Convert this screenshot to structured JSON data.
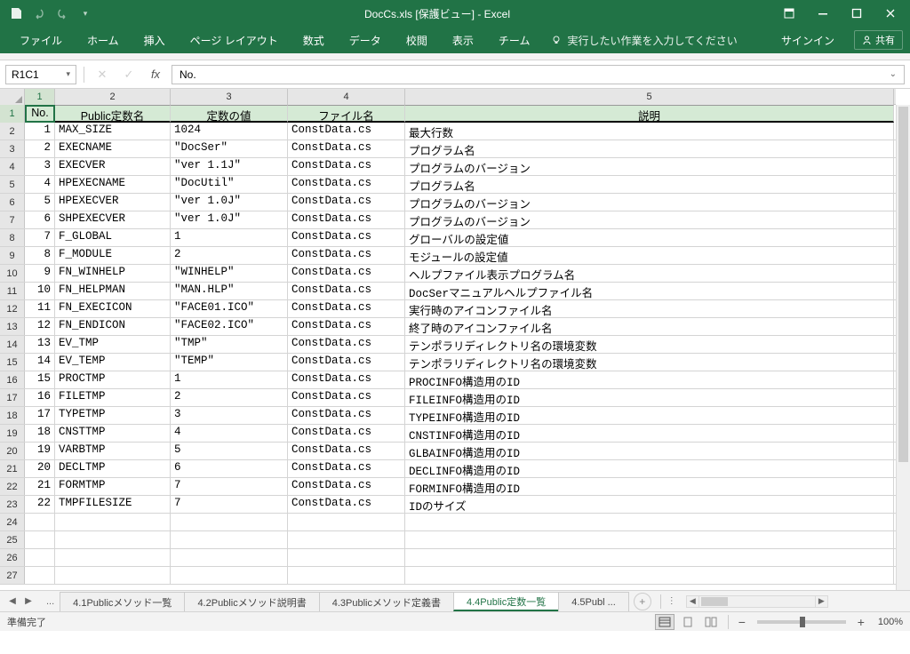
{
  "window": {
    "title": "DocCs.xls  [保護ビュー] - Excel",
    "signin": "サインイン",
    "share": "共有"
  },
  "ribbon": {
    "tabs": [
      "ファイル",
      "ホーム",
      "挿入",
      "ページ レイアウト",
      "数式",
      "データ",
      "校閲",
      "表示",
      "チーム"
    ],
    "tell_me": "実行したい作業を入力してください"
  },
  "formula_bar": {
    "name_box": "R1C1",
    "value": "No."
  },
  "columns": [
    "1",
    "2",
    "3",
    "4",
    "5"
  ],
  "headers": {
    "no": "No.",
    "name": "Public定数名",
    "val": "定数の値",
    "file": "ファイル名",
    "desc": "説明"
  },
  "rows": [
    {
      "no": "1",
      "name": "MAX_SIZE",
      "val": "1024",
      "file": "ConstData.cs",
      "desc": "最大行数"
    },
    {
      "no": "2",
      "name": "EXECNAME",
      "val": "\"DocSer\"",
      "file": "ConstData.cs",
      "desc": "プログラム名"
    },
    {
      "no": "3",
      "name": "EXECVER",
      "val": "\"ver 1.1J\"",
      "file": "ConstData.cs",
      "desc": "プログラムのバージョン"
    },
    {
      "no": "4",
      "name": "HPEXECNAME",
      "val": "\"DocUtil\"",
      "file": "ConstData.cs",
      "desc": "プログラム名"
    },
    {
      "no": "5",
      "name": "HPEXECVER",
      "val": "\"ver 1.0J\"",
      "file": "ConstData.cs",
      "desc": "プログラムのバージョン"
    },
    {
      "no": "6",
      "name": "SHPEXECVER",
      "val": "\"ver 1.0J\"",
      "file": "ConstData.cs",
      "desc": "プログラムのバージョン"
    },
    {
      "no": "7",
      "name": "F_GLOBAL",
      "val": "1",
      "file": "ConstData.cs",
      "desc": "グローバルの設定値"
    },
    {
      "no": "8",
      "name": "F_MODULE",
      "val": "2",
      "file": "ConstData.cs",
      "desc": "モジュールの設定値"
    },
    {
      "no": "9",
      "name": "FN_WINHELP",
      "val": "\"WINHELP\"",
      "file": "ConstData.cs",
      "desc": "ヘルプファイル表示プログラム名"
    },
    {
      "no": "10",
      "name": "FN_HELPMAN",
      "val": "\"MAN.HLP\"",
      "file": "ConstData.cs",
      "desc": "DocSerマニュアルヘルプファイル名"
    },
    {
      "no": "11",
      "name": "FN_EXECICON",
      "val": "\"FACE01.ICO\"",
      "file": "ConstData.cs",
      "desc": "実行時のアイコンファイル名"
    },
    {
      "no": "12",
      "name": "FN_ENDICON",
      "val": "\"FACE02.ICO\"",
      "file": "ConstData.cs",
      "desc": "終了時のアイコンファイル名"
    },
    {
      "no": "13",
      "name": "EV_TMP",
      "val": "\"TMP\"",
      "file": "ConstData.cs",
      "desc": "テンポラリディレクトリ名の環境変数"
    },
    {
      "no": "14",
      "name": "EV_TEMP",
      "val": "\"TEMP\"",
      "file": "ConstData.cs",
      "desc": "テンポラリディレクトリ名の環境変数"
    },
    {
      "no": "15",
      "name": "PROCTMP",
      "val": "1",
      "file": "ConstData.cs",
      "desc": "PROCINFO構造用のID"
    },
    {
      "no": "16",
      "name": "FILETMP",
      "val": "2",
      "file": "ConstData.cs",
      "desc": "FILEINFO構造用のID"
    },
    {
      "no": "17",
      "name": "TYPETMP",
      "val": "3",
      "file": "ConstData.cs",
      "desc": "TYPEINFO構造用のID"
    },
    {
      "no": "18",
      "name": "CNSTTMP",
      "val": "4",
      "file": "ConstData.cs",
      "desc": "CNSTINFO構造用のID"
    },
    {
      "no": "19",
      "name": "VARBTMP",
      "val": "5",
      "file": "ConstData.cs",
      "desc": "GLBAINFO構造用のID"
    },
    {
      "no": "20",
      "name": "DECLTMP",
      "val": "6",
      "file": "ConstData.cs",
      "desc": "DECLINFO構造用のID"
    },
    {
      "no": "21",
      "name": "FORMTMP",
      "val": "7",
      "file": "ConstData.cs",
      "desc": "FORMINFO構造用のID"
    },
    {
      "no": "22",
      "name": "TMPFILESIZE",
      "val": "7",
      "file": "ConstData.cs",
      "desc": "IDのサイズ"
    }
  ],
  "empty_rows": [
    "24",
    "25",
    "26",
    "27"
  ],
  "sheets": {
    "list": [
      "4.1Publicメソッド一覧",
      "4.2Publicメソッド説明書",
      "4.3Publicメソッド定義書",
      "4.4Public定数一覧",
      "4.5Publ ..."
    ],
    "active_index": 3,
    "ellipsis": "..."
  },
  "status": {
    "ready": "準備完了",
    "zoom": "100%"
  }
}
